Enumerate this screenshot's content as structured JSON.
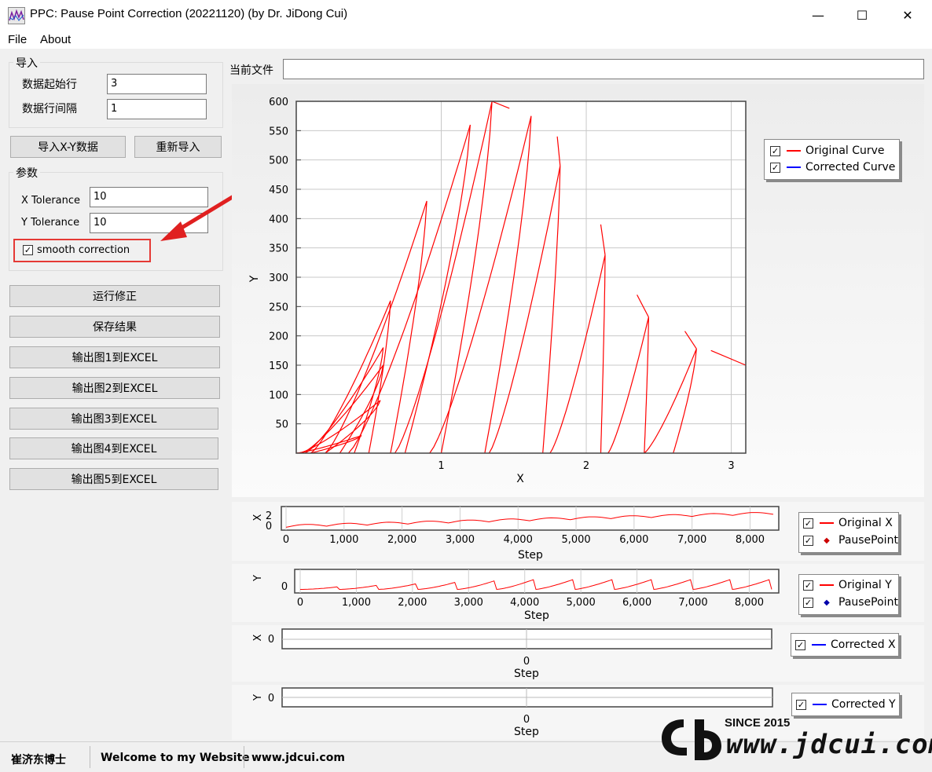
{
  "window": {
    "title": "PPC: Pause Point Correction (20221120) (by Dr. JiDong Cui)",
    "controls": {
      "minimize": "—",
      "maximize": "☐",
      "close": "✕"
    }
  },
  "menu": {
    "file": "File",
    "about": "About"
  },
  "import_group": {
    "title": "导入",
    "start_row_label": "数据起始行",
    "start_row_value": "3",
    "interval_label": "数据行间隔",
    "interval_value": "1"
  },
  "buttons": {
    "import_xy": "导入X-Y数据",
    "reimport": "重新导入",
    "run": "运行修正",
    "save": "保存结果",
    "export1": "输出图1到EXCEL",
    "export2": "输出图2到EXCEL",
    "export3": "输出图3到EXCEL",
    "export4": "输出图4到EXCEL",
    "export5": "输出图5到EXCEL"
  },
  "params_group": {
    "title": "参数",
    "x_tol_label": "X Tolerance",
    "x_tol_value": "10",
    "y_tol_label": "Y Tolerance",
    "y_tol_value": "10",
    "smooth_label": "smooth correction",
    "smooth_checked": true
  },
  "current_file": {
    "label": "当前文件",
    "value": ""
  },
  "main_chart": {
    "xlabel": "X",
    "ylabel": "Y",
    "y_ticks": [
      "600",
      "550",
      "500",
      "450",
      "400",
      "350",
      "300",
      "250",
      "200",
      "150",
      "100",
      "50"
    ],
    "x_ticks": [
      "1",
      "2",
      "3"
    ],
    "legend": [
      {
        "label": "Original Curve",
        "color": "#ff0000",
        "checked": true
      },
      {
        "label": "Corrected Curve",
        "color": "#0000ff",
        "checked": true
      }
    ]
  },
  "chart_x_step": {
    "ylabel": "X",
    "y_ticks": [
      "2",
      "0"
    ],
    "x_ticks": [
      "0",
      "1,000",
      "2,000",
      "3,000",
      "4,000",
      "5,000",
      "6,000",
      "7,000",
      "8,000"
    ],
    "xlabel": "Step",
    "legend": [
      {
        "label": "Original X",
        "color": "#ff0000",
        "checked": true
      },
      {
        "label": "PausePoint",
        "color": "#cc0000",
        "checked": true
      }
    ]
  },
  "chart_y_step": {
    "ylabel": "Y",
    "y_ticks": [
      "0"
    ],
    "x_ticks": [
      "0",
      "1,000",
      "2,000",
      "3,000",
      "4,000",
      "5,000",
      "6,000",
      "7,000",
      "8,000"
    ],
    "xlabel": "Step",
    "legend": [
      {
        "label": "Original Y",
        "color": "#ff0000",
        "checked": true
      },
      {
        "label": "PausePoint",
        "color": "#0000aa",
        "checked": true
      }
    ]
  },
  "chart_cx": {
    "ylabel": "X",
    "y_ticks": [
      "0"
    ],
    "x_ticks": [
      "0"
    ],
    "xlabel": "Step",
    "legend": [
      {
        "label": "Corrected X",
        "color": "#0000ff",
        "checked": true
      }
    ]
  },
  "chart_cy": {
    "ylabel": "Y",
    "y_ticks": [
      "0"
    ],
    "x_ticks": [
      "0"
    ],
    "xlabel": "Step",
    "legend": [
      {
        "label": "Corrected Y",
        "color": "#0000ff",
        "checked": true
      }
    ]
  },
  "status": {
    "author": "崔济东博士",
    "welcome": "Welcome to my Website",
    "url": "www.jdcui.com"
  },
  "watermark": {
    "since": "SINCE 2015",
    "site": "www.jdcui.com"
  }
}
